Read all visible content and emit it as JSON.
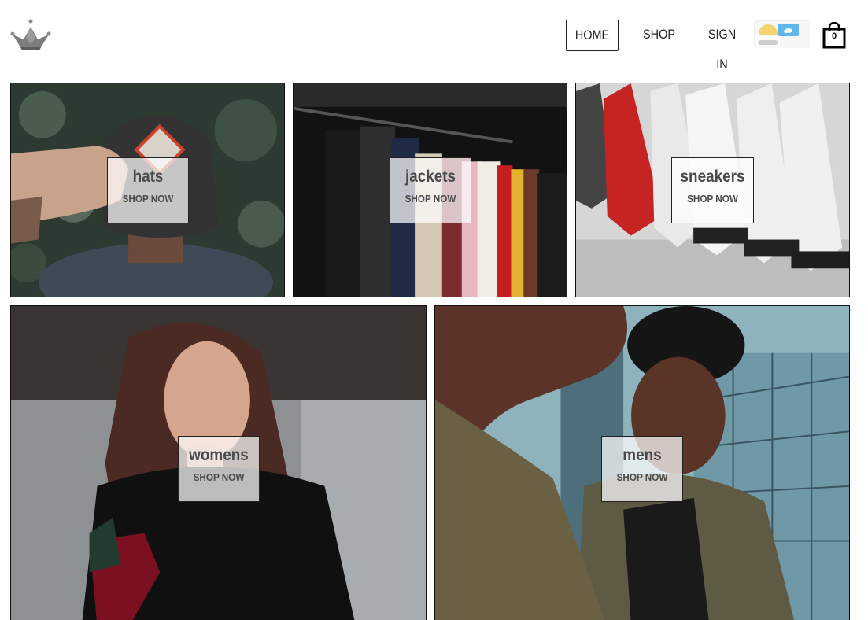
{
  "header": {
    "logo": "crown-logo-icon",
    "nav": {
      "home": "HOME",
      "shop": "SHOP",
      "sign_in": "SIGN IN"
    },
    "theme_toggle": "weather-theme-toggle-icon",
    "cart": {
      "icon": "shopping-bag-icon",
      "count": "0"
    }
  },
  "directory": {
    "items": [
      {
        "title": "hats",
        "subtitle": "SHOP NOW"
      },
      {
        "title": "jackets",
        "subtitle": "SHOP NOW"
      },
      {
        "title": "sneakers",
        "subtitle": "SHOP NOW"
      },
      {
        "title": "womens",
        "subtitle": "SHOP NOW"
      },
      {
        "title": "mens",
        "subtitle": "SHOP NOW"
      }
    ]
  },
  "colors": {
    "text": "#4a4a4a",
    "border": "#222222",
    "logo": "#808080",
    "background": "#ffffff"
  }
}
